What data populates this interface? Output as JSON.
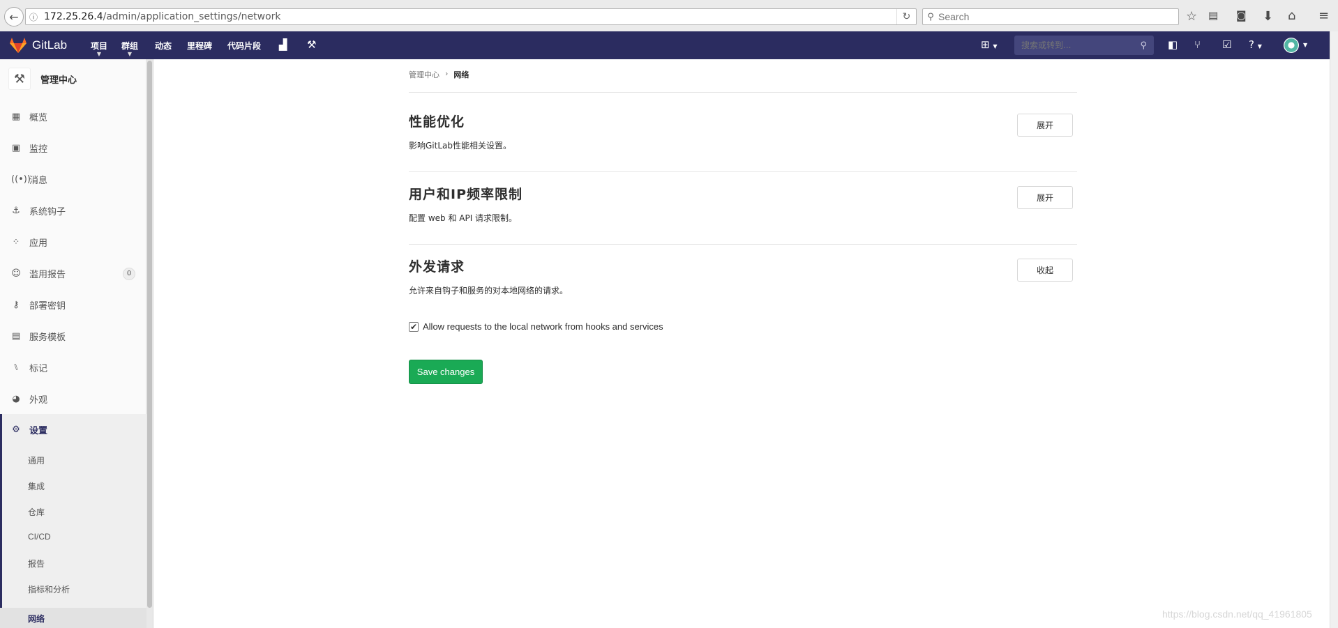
{
  "browser": {
    "url_host": "172.25.26.4",
    "url_path": "/admin/application_settings/network",
    "search_placeholder": "Search"
  },
  "topnav": {
    "brand": "GitLab",
    "items": [
      "项目",
      "群组",
      "动态",
      "里程碑",
      "代码片段"
    ],
    "search_placeholder": "搜索或转到..."
  },
  "sidebar": {
    "title": "管理中心",
    "items": [
      {
        "label": "概览",
        "icon": "grid-icon"
      },
      {
        "label": "监控",
        "icon": "monitor-icon"
      },
      {
        "label": "消息",
        "icon": "broadcast-icon"
      },
      {
        "label": "系统钩子",
        "icon": "hook-icon"
      },
      {
        "label": "应用",
        "icon": "apps-icon"
      },
      {
        "label": "滥用报告",
        "icon": "face-icon",
        "badge": "0"
      },
      {
        "label": "部署密钥",
        "icon": "key-icon"
      },
      {
        "label": "服务模板",
        "icon": "template-icon"
      },
      {
        "label": "标记",
        "icon": "labels-icon"
      },
      {
        "label": "外观",
        "icon": "palette-icon"
      }
    ],
    "settings": {
      "label": "设置",
      "subitems": [
        "通用",
        "集成",
        "仓库",
        "CI/CD",
        "报告",
        "指标和分析",
        "网络"
      ]
    }
  },
  "breadcrumb": {
    "parent": "管理中心",
    "separator": "›",
    "current": "网络"
  },
  "sections": [
    {
      "title": "性能优化",
      "description": "影响GitLab性能相关设置。",
      "button": "展开"
    },
    {
      "title": "用户和IP频率限制",
      "description": "配置 web 和 API 请求限制。",
      "button": "展开"
    },
    {
      "title": "外发请求",
      "description": "允许来自钩子和服务的对本地网络的请求。",
      "button": "收起"
    }
  ],
  "outbound": {
    "checkbox_label": "Allow requests to the local network from hooks and services",
    "checked": true,
    "save_label": "Save changes"
  },
  "watermark": "https://blog.csdn.net/qq_41961805",
  "colors": {
    "nav_bg": "#2b2c60",
    "save_green": "#1aaa55",
    "active_sidebar": "#2b2c60"
  }
}
